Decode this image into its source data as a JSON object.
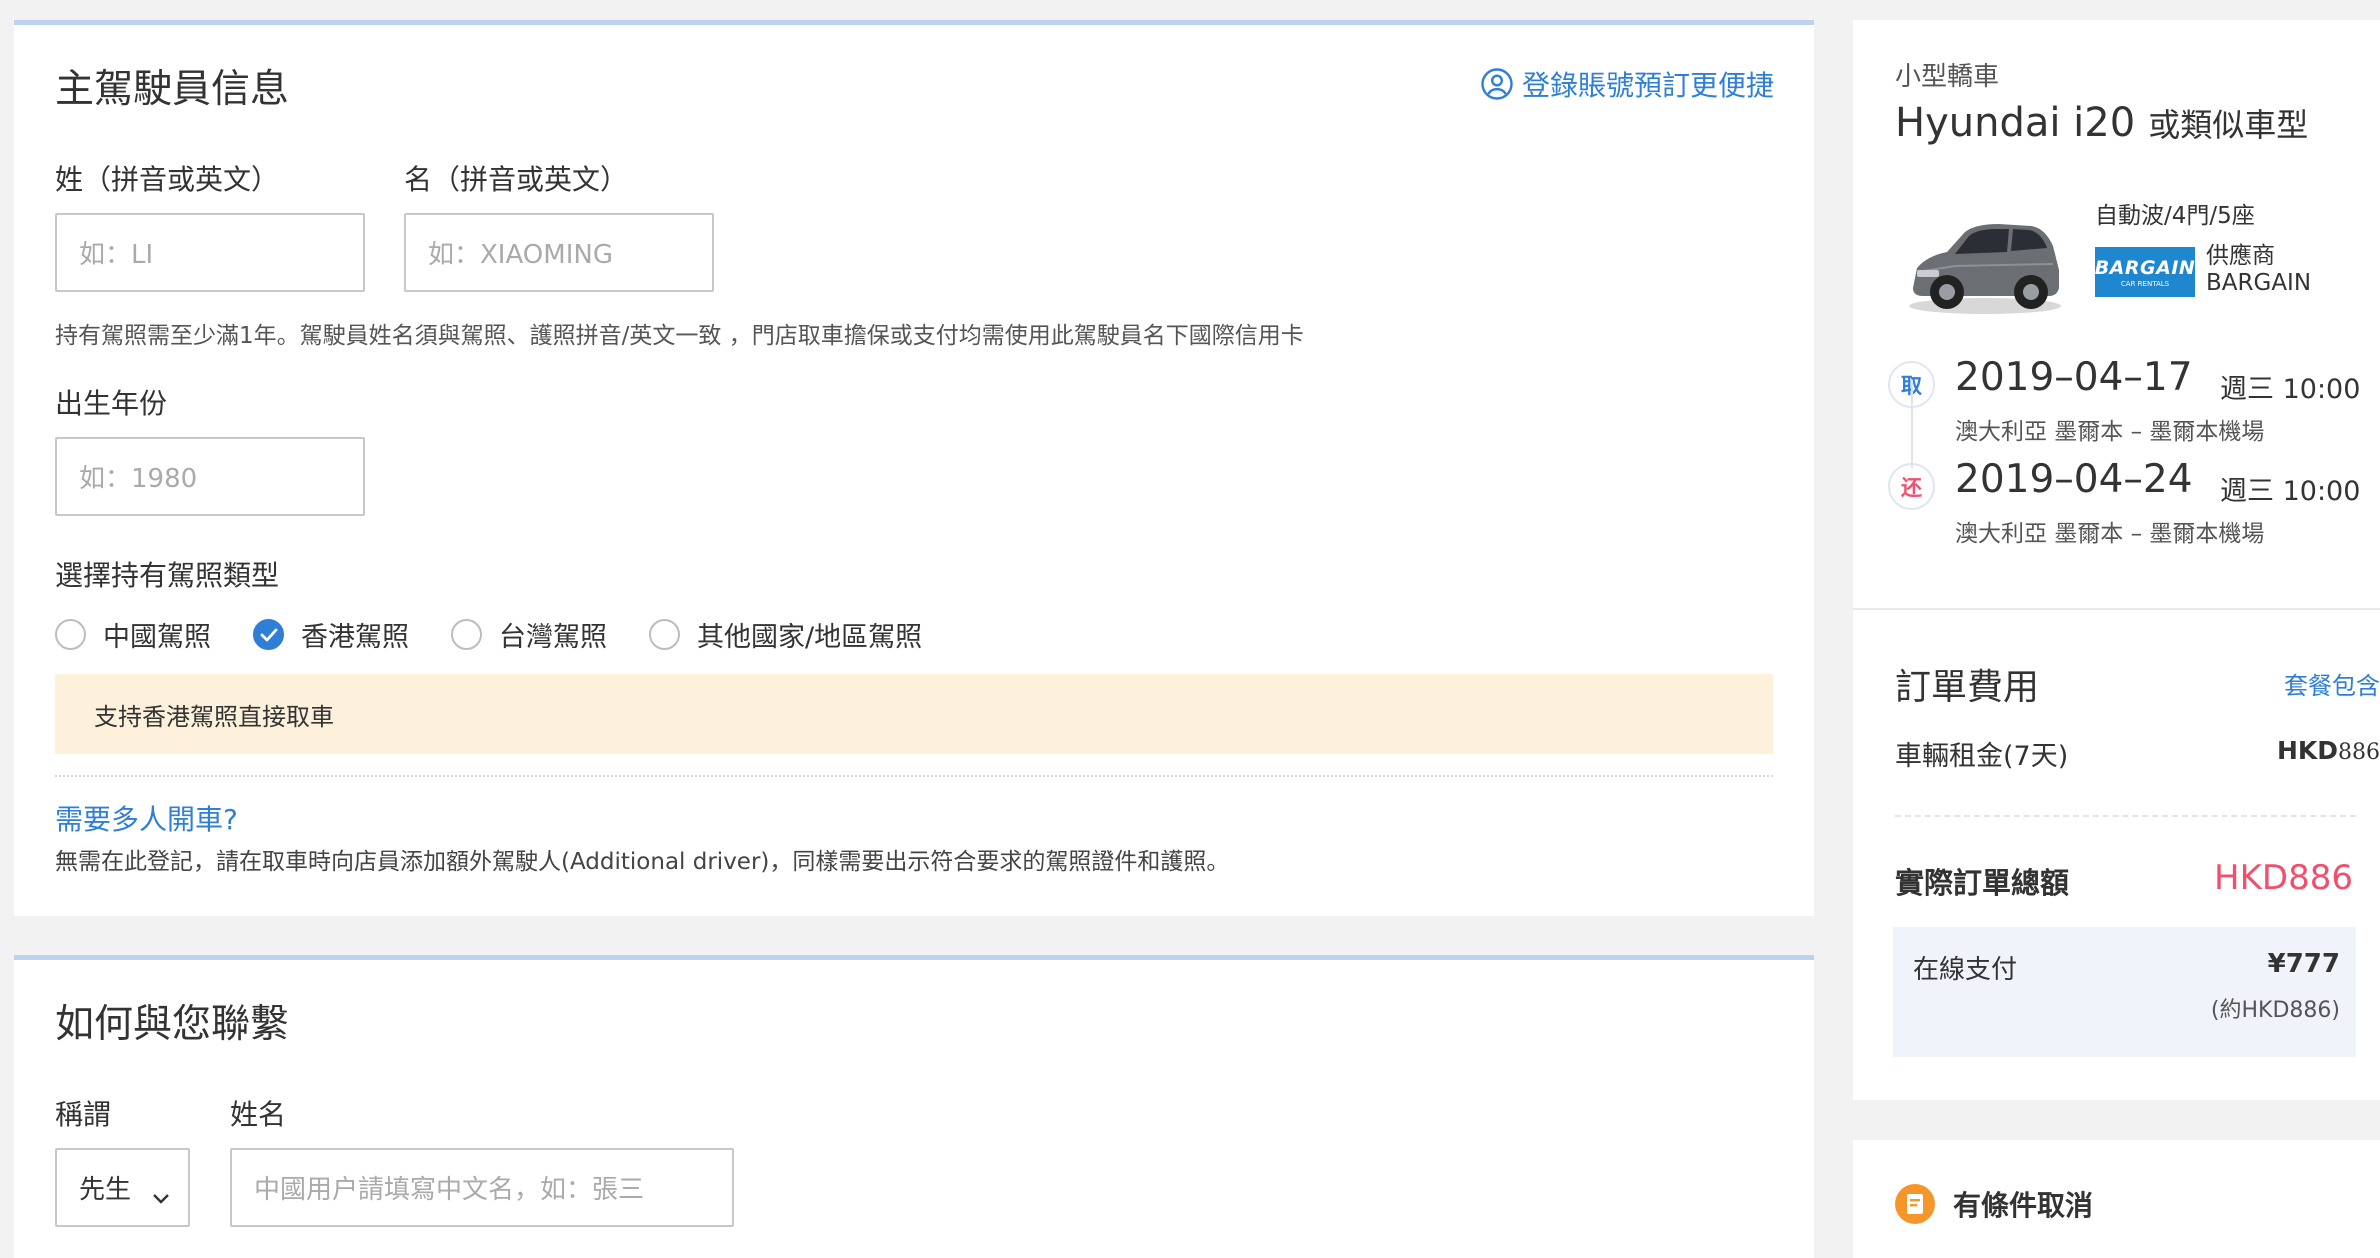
{
  "driver": {
    "title": "主駕駛員信息",
    "login_link": "登錄賬號預訂更便捷",
    "surname_label": "姓（拼音或英文）",
    "surname_placeholder": "如：LI",
    "given_label": "名（拼音或英文）",
    "given_placeholder": "如：XIAOMING",
    "license_note": "持有駕照需至少滿1年。駕駛員姓名須與駕照、護照拼音/英文一致 ，門店取車擔保或支付均需使用此駕駛員名下國際信用卡",
    "birth_label": "出生年份",
    "birth_placeholder": "如：1980",
    "license_type_label": "選擇持有駕照類型",
    "license_options": [
      {
        "label": "中國駕照",
        "checked": false
      },
      {
        "label": "香港駕照",
        "checked": true
      },
      {
        "label": "台灣駕照",
        "checked": false
      },
      {
        "label": "其他國家/地區駕照",
        "checked": false
      }
    ],
    "notice": "支持香港駕照直接取車",
    "multi_driver_link": "需要多人開車?",
    "multi_driver_note": "無需在此登記，請在取車時向店員添加額外駕駛人(Additional driver)，同樣需要出示符合要求的駕照證件和護照。"
  },
  "contact": {
    "title": "如何與您聯繫",
    "salutation_label": "稱謂",
    "salutation_value": "先生",
    "name_label": "姓名",
    "name_placeholder": "中國用户請填寫中文名，如：張三"
  },
  "car": {
    "category": "小型轎車",
    "model": "Hyundai i20",
    "model_suffix": "或類似車型",
    "specs": "自動波/4門/5座",
    "supplier_logo": "BARGAIN",
    "supplier_logo_sub": "CAR RENTALS",
    "supplier_label": "供應商",
    "supplier_name": "BARGAIN",
    "pickup_badge": "取",
    "pickup_date": "2019–04–17",
    "pickup_weekday": "週三 10:00",
    "pickup_location": "澳大利亞 墨爾本 – 墨爾本機場",
    "return_badge": "还",
    "return_date": "2019–04–24",
    "return_weekday": "週三 10:00",
    "return_location": "澳大利亞 墨爾本 – 墨爾本機場"
  },
  "fees": {
    "title": "訂單費用",
    "package_link": "套餐包含",
    "rental_label": "車輛租金(7天)",
    "rental_currency": "HKD",
    "rental_amount": "886",
    "total_label": "實際訂單總額",
    "total_value": "HKD886",
    "online_label": "在線支付",
    "online_value": "¥777",
    "online_approx": "(約HKD886)"
  },
  "policy": {
    "cancel_label": "有條件取消"
  },
  "colors": {
    "accent": "#2f7fd7",
    "total": "#f0506e",
    "notice_bg": "#fdf1dc",
    "cancel_icon": "#f5962b",
    "supplier_logo_bg": "#1f86d0"
  }
}
